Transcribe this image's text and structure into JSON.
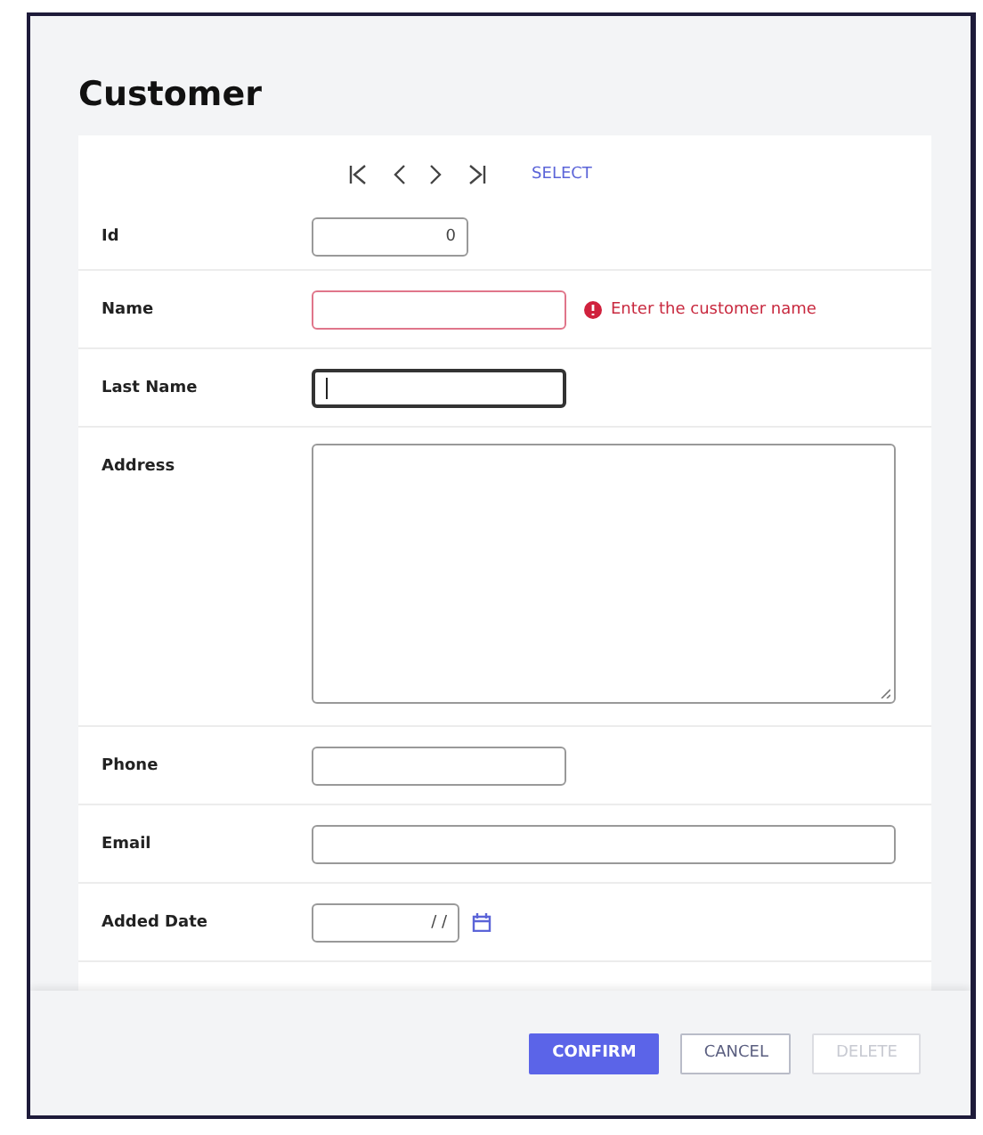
{
  "title": "Customer",
  "navigation": {
    "select_link": "SELECT"
  },
  "fields": [
    {
      "label": "Id",
      "kind": "number",
      "value": "0",
      "error": false,
      "focused": false
    },
    {
      "label": "Name",
      "kind": "text",
      "error": true,
      "error_message": "Enter the customer name",
      "focused": false
    },
    {
      "label": "Last Name",
      "kind": "text",
      "error": false,
      "focused": true
    },
    {
      "label": "Address",
      "kind": "textarea",
      "error": false,
      "focused": false
    },
    {
      "label": "Phone",
      "kind": "text",
      "error": false,
      "focused": false
    },
    {
      "label": "Email",
      "kind": "wide",
      "error": false,
      "focused": false
    },
    {
      "label": "Added Date",
      "kind": "date",
      "value": "/ /",
      "error": false,
      "focused": false
    }
  ],
  "buttons": [
    {
      "label": "CONFIRM",
      "kind": "primary",
      "disabled": false
    },
    {
      "label": "CANCEL",
      "kind": "secondary",
      "disabled": false
    },
    {
      "label": "DELETE",
      "kind": "secondary",
      "disabled": true
    }
  ]
}
